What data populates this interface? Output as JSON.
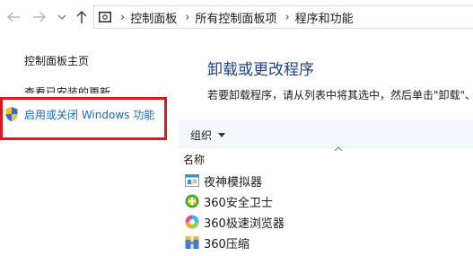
{
  "breadcrumb": {
    "separator": "›",
    "items": [
      "控制面板",
      "所有控制面板项",
      "程序和功能"
    ]
  },
  "left_pane": {
    "home_link": "控制面板主页",
    "updates_link": "查看已安装的更新",
    "features_link": "启用或关闭 Windows 功能"
  },
  "main": {
    "title": "卸载或更改程序",
    "description": "若要卸载程序，请从列表中将其选中，然后单击\"卸载\"、"
  },
  "toolbar": {
    "organize_label": "组织"
  },
  "list": {
    "name_header": "名称",
    "programs": [
      {
        "name": "夜神模拟器",
        "icon": "nox-emulator-icon"
      },
      {
        "name": "360安全卫士",
        "icon": "360-safeguard-icon"
      },
      {
        "name": "360极速浏览器",
        "icon": "360-browser-icon"
      },
      {
        "name": "360压缩",
        "icon": "360-zip-icon"
      }
    ]
  },
  "colors": {
    "title": "#1e3f8f",
    "link": "#1a66c8",
    "highlight_border": "#e0181e",
    "toolbar_bg": "#f4f7fc"
  }
}
